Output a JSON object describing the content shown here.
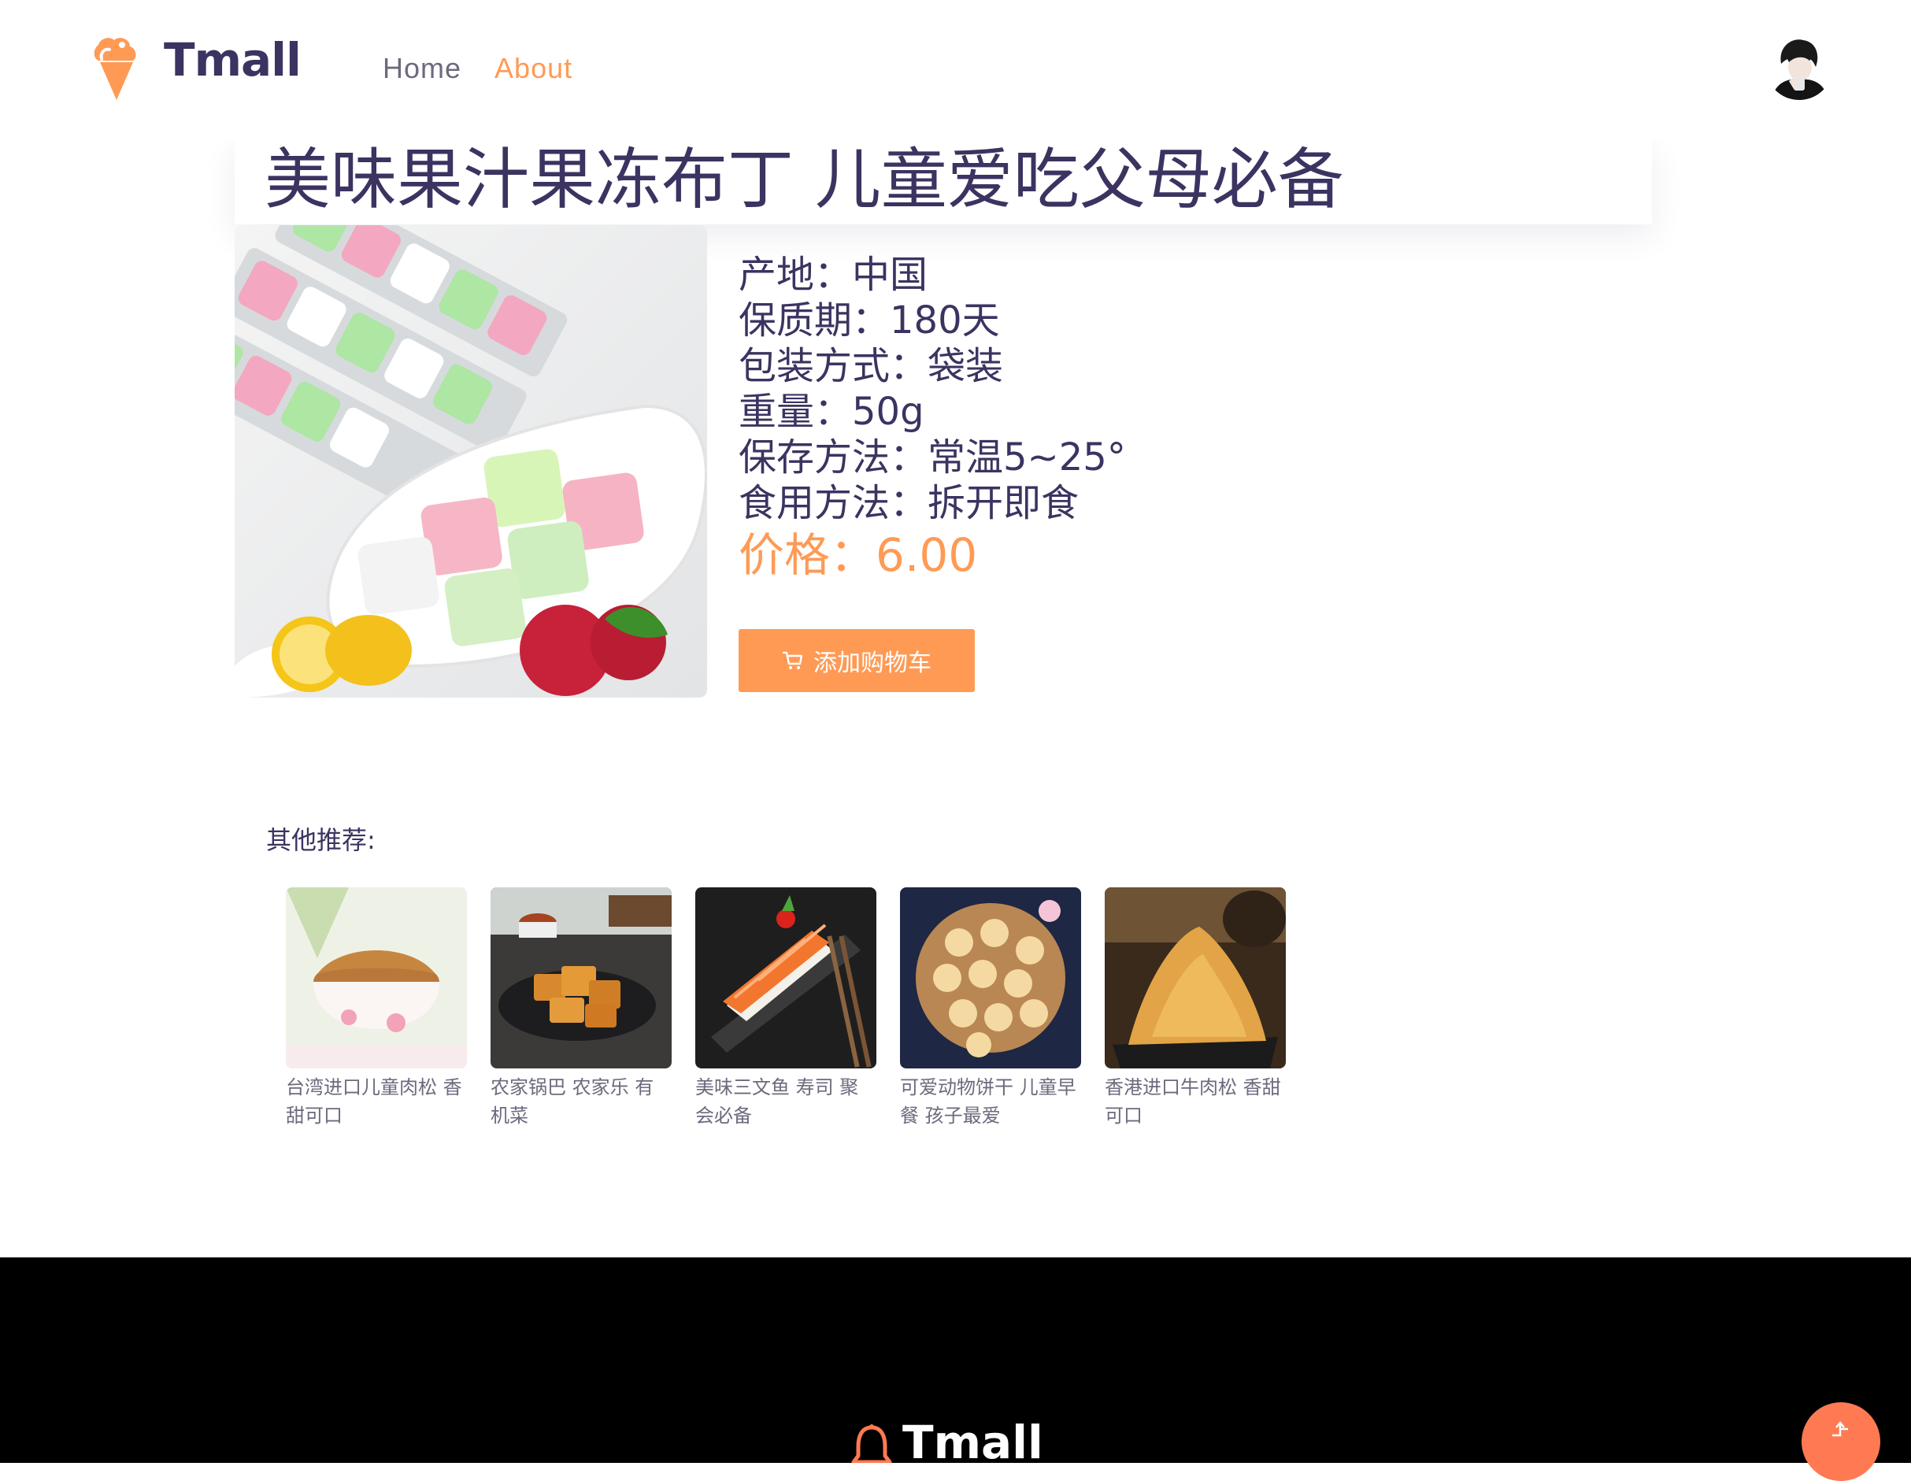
{
  "header": {
    "logo_text": "Tmall",
    "nav": [
      {
        "label": "Home",
        "active": false
      },
      {
        "label": "About",
        "active": true
      }
    ],
    "avatar_icon": "user-avatar",
    "logo_icon": "ice-cream-cone-icon"
  },
  "product": {
    "title": "美味果汁果冻布丁 儿童爱吃父母必备",
    "specs": [
      "产地：中国",
      "保质期：180天",
      "包装方式：袋装",
      "重量：50g",
      "保存方法：常温5~25°",
      "食用方法：拆开即食"
    ],
    "price": "价格：6.00",
    "cart_button": "添加购物车",
    "cart_icon": "shopping-cart-icon"
  },
  "recommendations": {
    "title": "其他推荐:",
    "items": [
      {
        "name": "台湾进口儿童肉松 香甜可口"
      },
      {
        "name": "农家锅巴 农家乐 有机菜"
      },
      {
        "name": "美味三文鱼 寿司 聚会必备"
      },
      {
        "name": "可爱动物饼干 儿童早餐 孩子最爱"
      },
      {
        "name": "香港进口牛肉松 香甜可口"
      }
    ]
  },
  "footer": {
    "logo_text": "Tmall",
    "logo_icon": "bell-icon",
    "back_to_top_icon": "arrow-up-icon"
  },
  "colors": {
    "accent": "#ff9a55",
    "text_primary": "#3c3361",
    "text_secondary": "#6c6a7d",
    "footer_bg": "#000000"
  }
}
